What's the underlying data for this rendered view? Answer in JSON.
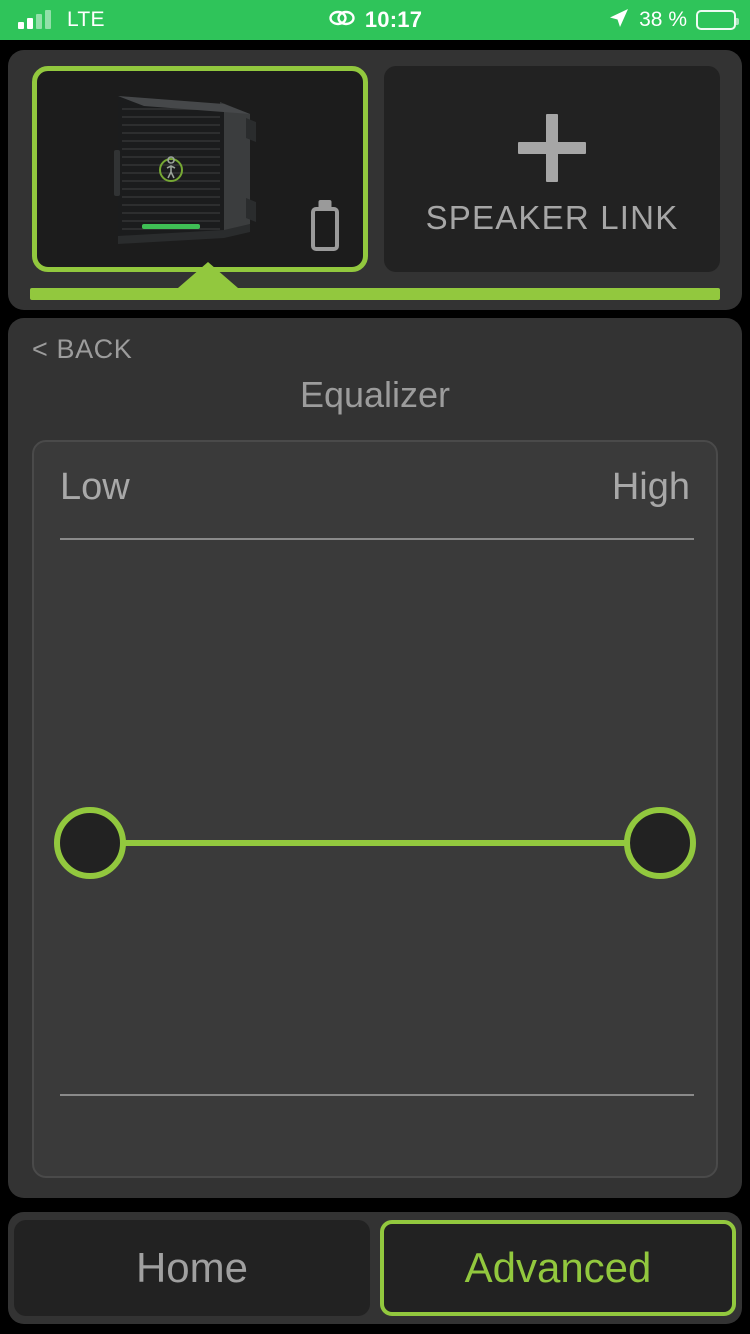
{
  "theme": {
    "accent_green": "#92c83e",
    "status_bar_green": "#2fc45a",
    "panel_bg": "#333333",
    "card_bg": "#222222",
    "muted_text": "#9c9c9c"
  },
  "status_bar": {
    "carrier": "LTE",
    "signal_icon": "signal-bars-icon",
    "link_icon": "chain-link-icon",
    "time": "10:17",
    "location_icon": "location-arrow-icon",
    "battery_text": "38 %",
    "battery_percent": 38,
    "battery_icon": "battery-icon"
  },
  "speaker_panel": {
    "selected_speaker": {
      "name": "speaker-thumbnail",
      "brand_logo_icon": "mackie-logo-icon",
      "battery_icon": "battery-empty-icon",
      "selected": true
    },
    "add_speaker": {
      "plus_icon": "plus-icon",
      "label": "SPEAKER LINK"
    },
    "selection_indicator_icon": "selection-arrow-icon"
  },
  "content": {
    "back_label": "< BACK",
    "back_icon": "chevron-left-icon",
    "title": "Equalizer",
    "equalizer": {
      "low_label": "Low",
      "high_label": "High",
      "low_handle_name": "low-band-handle",
      "high_handle_name": "high-band-handle"
    }
  },
  "bottom_nav": {
    "home_label": "Home",
    "advanced_label": "Advanced",
    "active": "Advanced"
  }
}
